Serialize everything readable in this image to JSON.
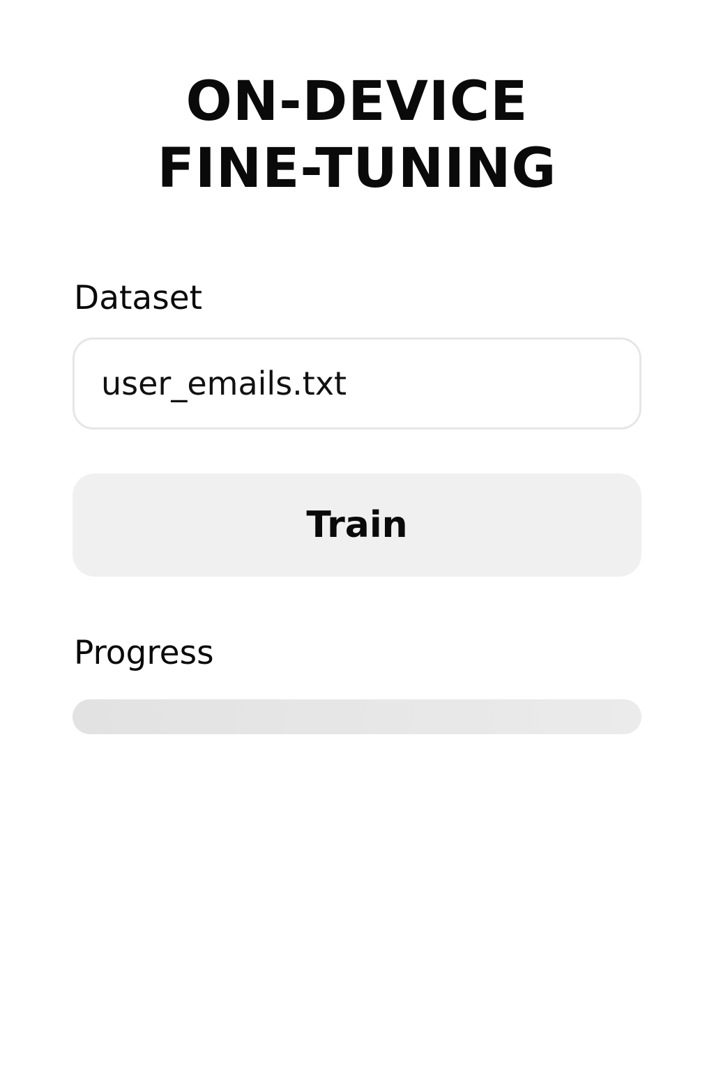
{
  "header": {
    "title_line1": "ON-DEVICE",
    "title_line2": "FINE-TUNING"
  },
  "dataset": {
    "label": "Dataset",
    "value": "user_emails.txt"
  },
  "train_button": {
    "label": "Train"
  },
  "progress": {
    "label": "Progress",
    "fraction": 0
  }
}
